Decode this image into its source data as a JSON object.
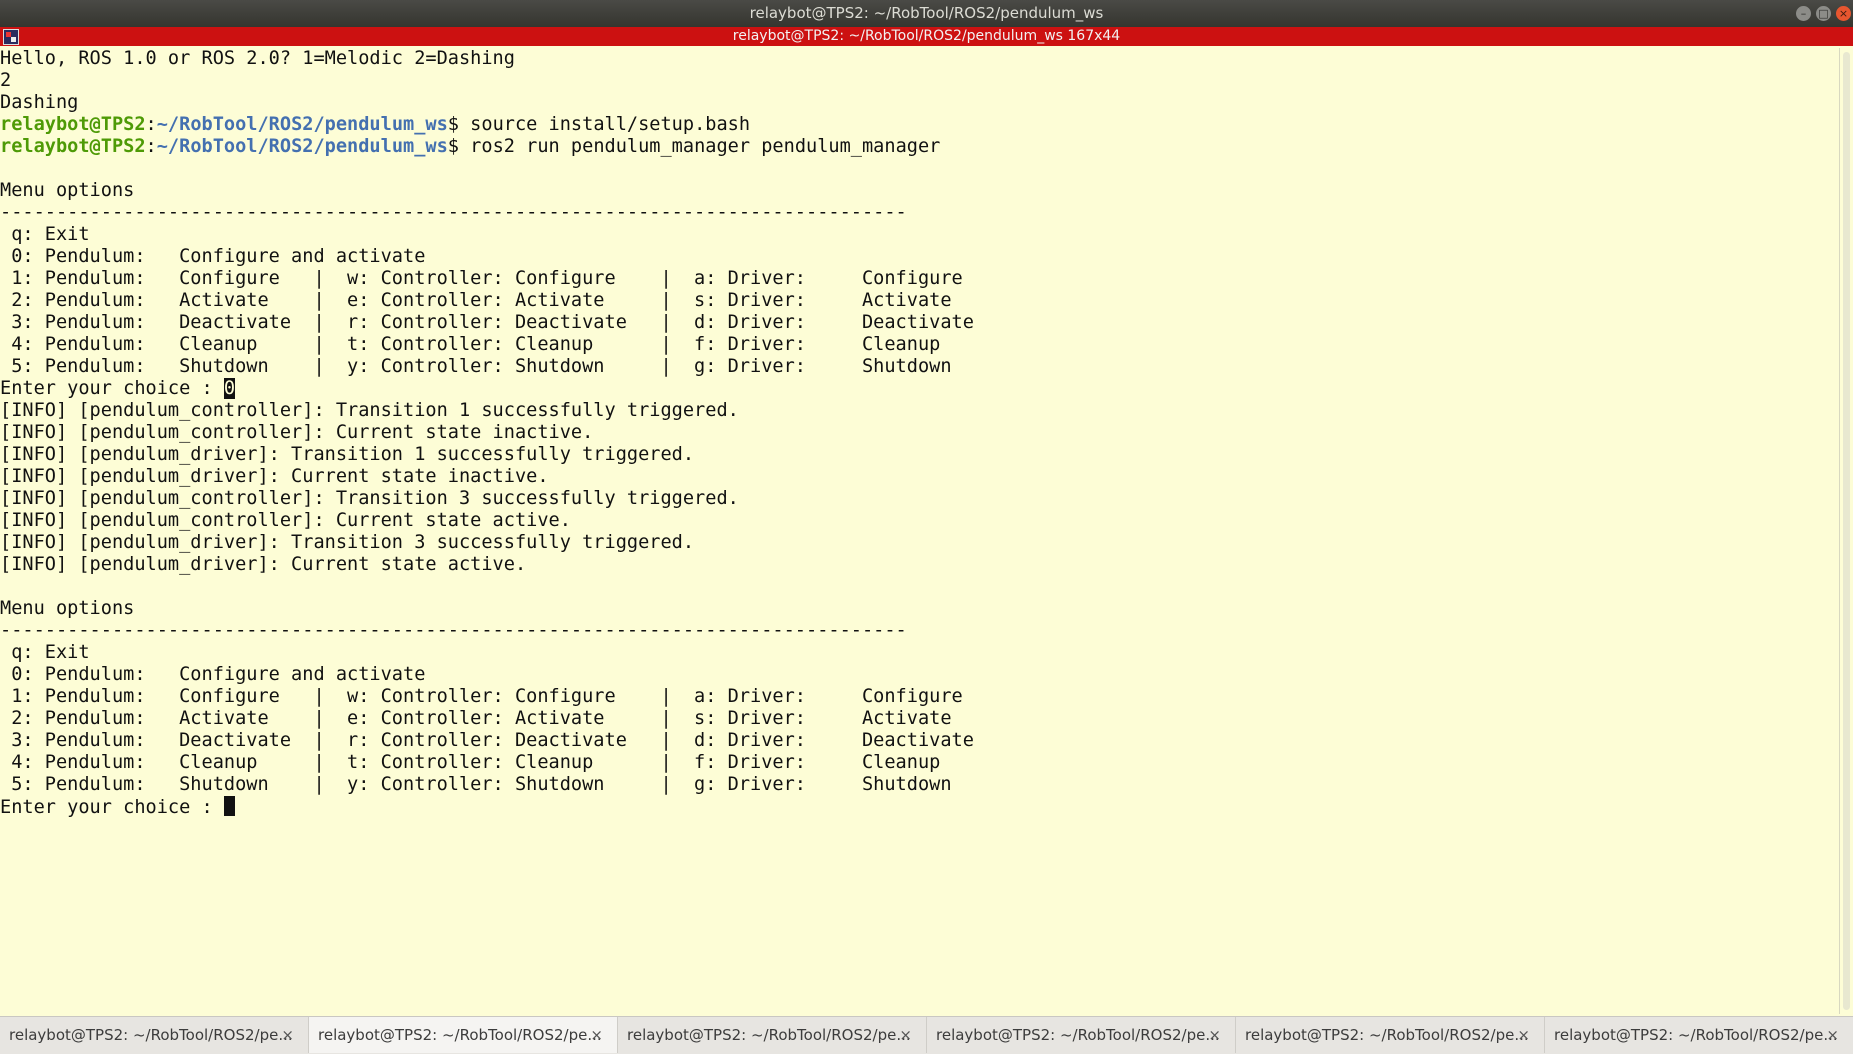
{
  "window": {
    "title": "relaybot@TPS2: ~/RobTool/ROS2/pendulum_ws",
    "subtitle": "relaybot@TPS2: ~/RobTool/ROS2/pendulum_ws 167x44",
    "controls": {
      "minimize": "–",
      "maximize": "□",
      "close": "×"
    }
  },
  "terminal": {
    "lines": [
      [
        "Hello, ROS 1.0 or ROS 2.0? 1=Melodic 2=Dashing"
      ],
      [
        "2"
      ],
      [
        "Dashing"
      ],
      [
        {
          "u": "relaybot@TPS2"
        },
        ":",
        {
          "p": "~/RobTool/ROS2/pendulum_ws"
        },
        "$ source install/setup.bash"
      ],
      [
        {
          "u": "relaybot@TPS2"
        },
        ":",
        {
          "p": "~/RobTool/ROS2/pendulum_ws"
        },
        "$ ros2 run pendulum_manager pendulum_manager"
      ],
      [
        ""
      ],
      [
        "Menu options"
      ],
      [
        "---------------------------------------------------------------------------------"
      ],
      [
        " q: Exit"
      ],
      [
        " 0: Pendulum:   Configure and activate"
      ],
      [
        " 1: Pendulum:   Configure   |  w: Controller: Configure    |  a: Driver:     Configure"
      ],
      [
        " 2: Pendulum:   Activate    |  e: Controller: Activate     |  s: Driver:     Activate"
      ],
      [
        " 3: Pendulum:   Deactivate  |  r: Controller: Deactivate   |  d: Driver:     Deactivate"
      ],
      [
        " 4: Pendulum:   Cleanup     |  t: Controller: Cleanup      |  f: Driver:     Cleanup"
      ],
      [
        " 5: Pendulum:   Shutdown    |  y: Controller: Shutdown     |  g: Driver:     Shutdown"
      ],
      [
        "Enter your choice : ",
        {
          "box": "0"
        }
      ],
      [
        "[INFO] [pendulum_controller]: Transition 1 successfully triggered."
      ],
      [
        "[INFO] [pendulum_controller]: Current state inactive."
      ],
      [
        "[INFO] [pendulum_driver]: Transition 1 successfully triggered."
      ],
      [
        "[INFO] [pendulum_driver]: Current state inactive."
      ],
      [
        "[INFO] [pendulum_controller]: Transition 3 successfully triggered."
      ],
      [
        "[INFO] [pendulum_controller]: Current state active."
      ],
      [
        "[INFO] [pendulum_driver]: Transition 3 successfully triggered."
      ],
      [
        "[INFO] [pendulum_driver]: Current state active."
      ],
      [
        ""
      ],
      [
        "Menu options"
      ],
      [
        "---------------------------------------------------------------------------------"
      ],
      [
        " q: Exit"
      ],
      [
        " 0: Pendulum:   Configure and activate"
      ],
      [
        " 1: Pendulum:   Configure   |  w: Controller: Configure    |  a: Driver:     Configure"
      ],
      [
        " 2: Pendulum:   Activate    |  e: Controller: Activate     |  s: Driver:     Activate"
      ],
      [
        " 3: Pendulum:   Deactivate  |  r: Controller: Deactivate   |  d: Driver:     Deactivate"
      ],
      [
        " 4: Pendulum:   Cleanup     |  t: Controller: Cleanup      |  f: Driver:     Cleanup"
      ],
      [
        " 5: Pendulum:   Shutdown    |  y: Controller: Shutdown     |  g: Driver:     Shutdown"
      ],
      [
        "Enter your choice : ",
        {
          "cursor": true
        }
      ]
    ]
  },
  "tabs": [
    {
      "label": "relaybot@TPS2: ~/RobTool/ROS2/pe...",
      "close": "×",
      "active": false
    },
    {
      "label": "relaybot@TPS2: ~/RobTool/ROS2/pe...",
      "close": "×",
      "active": true
    },
    {
      "label": "relaybot@TPS2: ~/RobTool/ROS2/pe...",
      "close": "×",
      "active": false
    },
    {
      "label": "relaybot@TPS2: ~/RobTool/ROS2/pe...",
      "close": "×",
      "active": false
    },
    {
      "label": "relaybot@TPS2: ~/RobTool/ROS2/pe...",
      "close": "×",
      "active": false
    },
    {
      "label": "relaybot@TPS2: ~/RobTool/ROS2/pe...",
      "close": "×",
      "active": false
    }
  ]
}
